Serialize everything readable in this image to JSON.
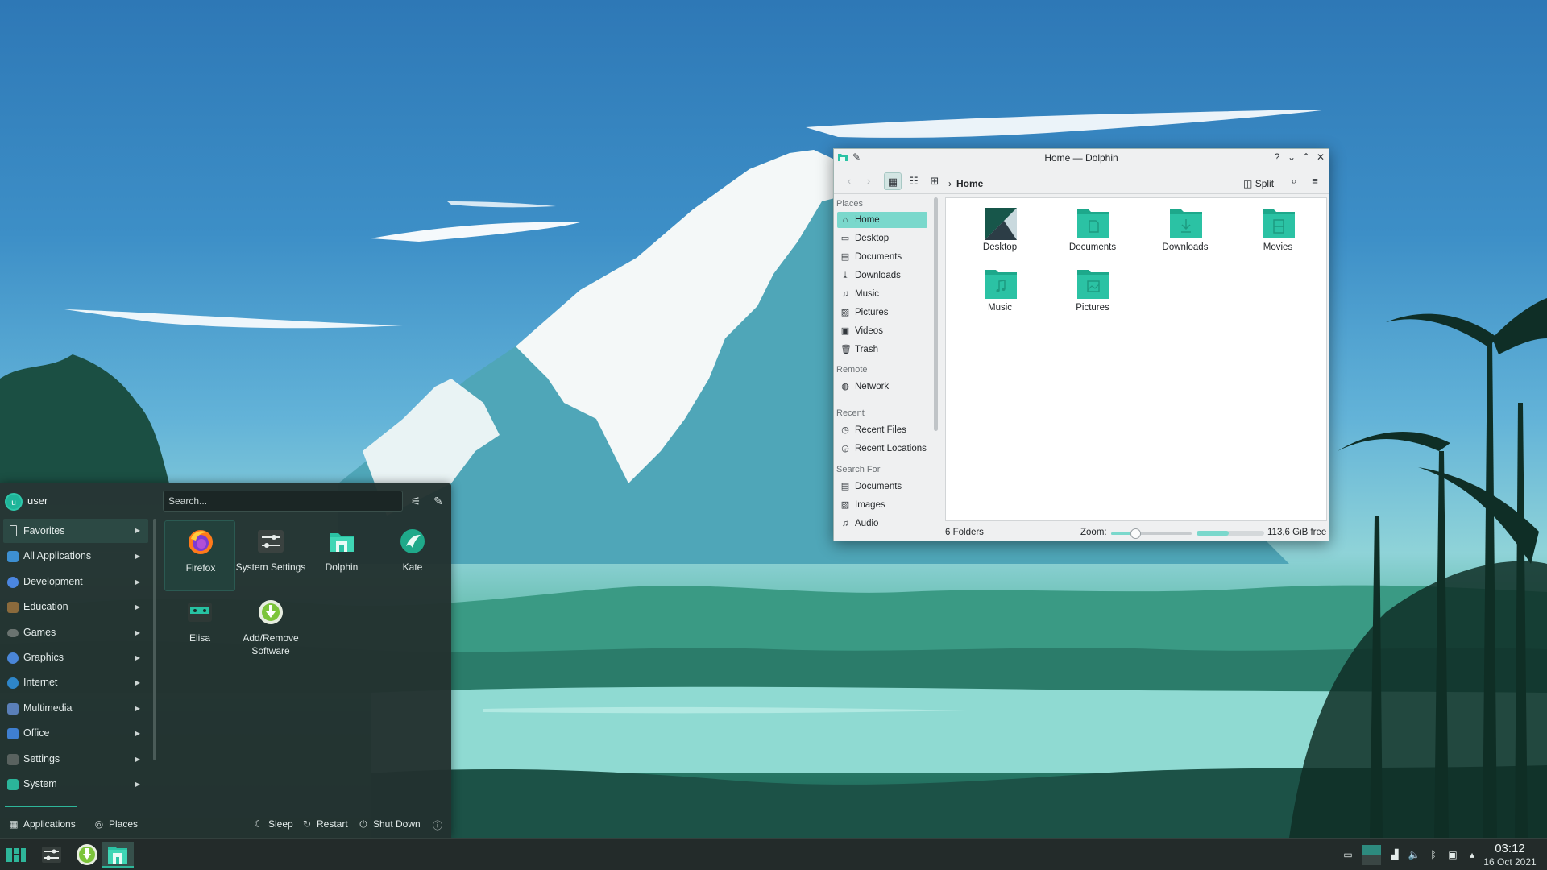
{
  "launcher": {
    "username": "user",
    "avatar_letter": "u",
    "search_placeholder": "Search...",
    "categories": [
      {
        "label": "Favorites",
        "icon": "bookmark-icon"
      },
      {
        "label": "All Applications",
        "icon": "grid-icon"
      },
      {
        "label": "Development",
        "icon": "development-icon"
      },
      {
        "label": "Education",
        "icon": "education-icon"
      },
      {
        "label": "Games",
        "icon": "gamepad-icon"
      },
      {
        "label": "Graphics",
        "icon": "graphics-icon"
      },
      {
        "label": "Internet",
        "icon": "globe-icon"
      },
      {
        "label": "Multimedia",
        "icon": "multimedia-icon"
      },
      {
        "label": "Office",
        "icon": "office-icon"
      },
      {
        "label": "Settings",
        "icon": "settings-icon"
      },
      {
        "label": "System",
        "icon": "system-icon"
      }
    ],
    "apps": [
      {
        "label": "Firefox",
        "icon": "firefox-icon"
      },
      {
        "label": "System Settings",
        "icon": "system-settings-icon"
      },
      {
        "label": "Dolphin",
        "icon": "dolphin-icon"
      },
      {
        "label": "Kate",
        "icon": "kate-icon"
      },
      {
        "label": "Elisa",
        "icon": "elisa-icon"
      },
      {
        "label": "Add/Remove Software",
        "icon": "discover-icon"
      }
    ],
    "footer": {
      "applications": "Applications",
      "places": "Places",
      "sleep": "Sleep",
      "restart": "Restart",
      "shutdown": "Shut Down"
    }
  },
  "dolphin": {
    "title": "Home — Dolphin",
    "breadcrumb": "Home",
    "split_label": "Split",
    "places_sections": {
      "places": "Places",
      "remote": "Remote",
      "recent": "Recent",
      "search_for": "Search For"
    },
    "places": [
      {
        "label": "Home",
        "icon": "home-icon"
      },
      {
        "label": "Desktop",
        "icon": "desktop-icon"
      },
      {
        "label": "Documents",
        "icon": "document-icon"
      },
      {
        "label": "Downloads",
        "icon": "download-icon"
      },
      {
        "label": "Music",
        "icon": "music-icon"
      },
      {
        "label": "Pictures",
        "icon": "picture-icon"
      },
      {
        "label": "Videos",
        "icon": "video-icon"
      },
      {
        "label": "Trash",
        "icon": "trash-icon"
      }
    ],
    "remote": [
      {
        "label": "Network",
        "icon": "network-icon"
      }
    ],
    "recent": [
      {
        "label": "Recent Files",
        "icon": "recent-files-icon"
      },
      {
        "label": "Recent Locations",
        "icon": "recent-locations-icon"
      }
    ],
    "search_for": [
      {
        "label": "Documents",
        "icon": "document-icon"
      },
      {
        "label": "Images",
        "icon": "picture-icon"
      },
      {
        "label": "Audio",
        "icon": "music-icon"
      }
    ],
    "folders": [
      {
        "label": "Desktop",
        "icon": "desktop-folder-icon"
      },
      {
        "label": "Documents",
        "icon": "documents-folder-icon"
      },
      {
        "label": "Downloads",
        "icon": "downloads-folder-icon"
      },
      {
        "label": "Movies",
        "icon": "movies-folder-icon"
      },
      {
        "label": "Music",
        "icon": "music-folder-icon"
      },
      {
        "label": "Pictures",
        "icon": "pictures-folder-icon"
      }
    ],
    "status": {
      "count": "6 Folders",
      "zoom_label": "Zoom:",
      "zoom_level": 0.3,
      "space_used": 0.48,
      "free_space": "113,6 GiB free"
    }
  },
  "taskbar": {
    "time": "03:12",
    "date": "16 Oct 2021"
  },
  "colors": {
    "accent": "#2eb69a",
    "folder": "#2bc2a4",
    "selection": "#7ad8cc"
  }
}
